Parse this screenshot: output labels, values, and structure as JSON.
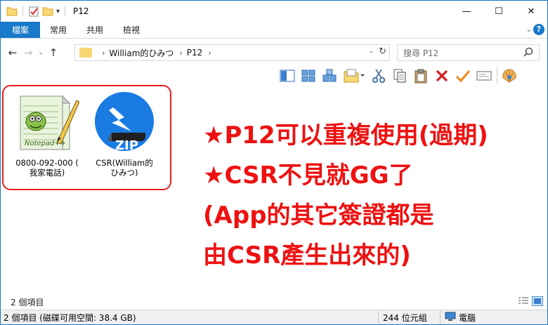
{
  "window": {
    "title": "P12",
    "controls": {
      "minimize": "—",
      "maximize": "☐",
      "close": "✕"
    }
  },
  "quick_access": {
    "icons": [
      "folder-icon",
      "properties-icon",
      "new-folder-icon",
      "dropdown-icon"
    ],
    "dropdown_glyph": "▾"
  },
  "ribbon": {
    "tabs": [
      {
        "label": "檔案",
        "active": true
      },
      {
        "label": "常用",
        "active": false
      },
      {
        "label": "共用",
        "active": false
      },
      {
        "label": "檢視",
        "active": false
      }
    ],
    "expand_glyph": "⌄",
    "help_glyph": "?"
  },
  "nav": {
    "back": "←",
    "forward": "→",
    "recent": "⌄",
    "up": "↑"
  },
  "address": {
    "chevron_before": "›",
    "crumbs": [
      "William的ひみつ",
      "P12"
    ],
    "chevron_mid": "›",
    "chevron_after": "›",
    "dropdown": "⌄",
    "refresh": "↻"
  },
  "search": {
    "placeholder": "搜尋 P12",
    "icon": "⚲"
  },
  "toolbar": {
    "icons": [
      "details-pane-icon",
      "large-icons-view-icon",
      "tiles-view-icon",
      "new-folder-menu-icon",
      "scissors-icon",
      "copy-icon",
      "paste-icon",
      "delete-icon",
      "check-icon",
      "mail-icon",
      "shell-icon"
    ]
  },
  "files": [
    {
      "icon": "notepad-plus-plus-icon",
      "name_line1": "0800-092-000 (",
      "name_line2": "我家電話)"
    },
    {
      "icon": "zip-archive-icon",
      "name_line1": "CSR(William的",
      "name_line2": "ひみつ)",
      "badge": "ZIP"
    }
  ],
  "annotation": {
    "lines": [
      "★P12可以重複使用(過期)",
      "★CSR不見就GG了",
      "(App的其它簽證都是",
      "由CSR產生出來的)"
    ]
  },
  "inner_status": {
    "count": "2 個項目"
  },
  "status_bar": {
    "items_summary": "2 個項目 (磁碟可用空間: 38.4 GB)",
    "size": "244 位元組",
    "location": "電腦"
  },
  "colors": {
    "accent": "#1979ca",
    "annotation_red": "#ee1111",
    "box_red": "#e61e1e"
  }
}
